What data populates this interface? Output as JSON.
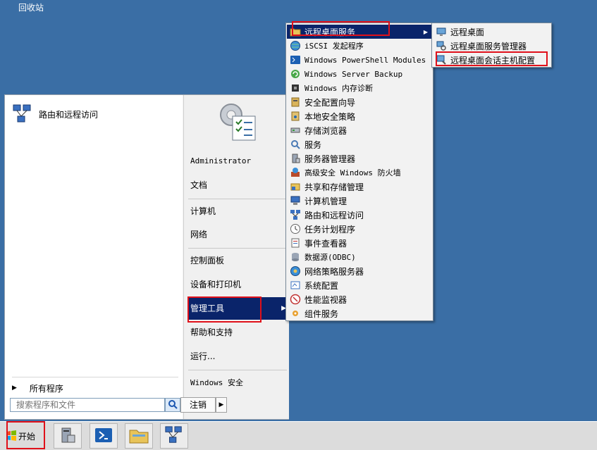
{
  "desktop": {
    "recycle_bin": "回收站"
  },
  "start_menu": {
    "pinned": [
      {
        "label": "路由和远程访问",
        "icon": "network-icon"
      }
    ],
    "all_programs": "所有程序",
    "search_placeholder": "搜索程序和文件",
    "right": {
      "user": "Administrator",
      "items": [
        "文档",
        "计算机",
        "网络",
        "控制面板",
        "设备和打印机",
        "管理工具",
        "帮助和支持",
        "运行..."
      ],
      "security": "Windows 安全",
      "logoff": "注销"
    }
  },
  "admin_tools_menu": {
    "items": [
      {
        "label": "远程桌面服务",
        "icon": "folder-icon"
      },
      {
        "label": "iSCSI 发起程序",
        "icon": "globe-icon"
      },
      {
        "label": "Windows PowerShell Modules",
        "icon": "powershell-icon"
      },
      {
        "label": "Windows Server Backup",
        "icon": "backup-icon"
      },
      {
        "label": "Windows 内存诊断",
        "icon": "chip-icon"
      },
      {
        "label": "安全配置向导",
        "icon": "wizard-icon"
      },
      {
        "label": "本地安全策略",
        "icon": "policy-icon"
      },
      {
        "label": "存储浏览器",
        "icon": "storage-icon"
      },
      {
        "label": "服务",
        "icon": "services-icon"
      },
      {
        "label": "服务器管理器",
        "icon": "server-icon"
      },
      {
        "label": "高级安全 Windows 防火墙",
        "icon": "firewall-icon"
      },
      {
        "label": "共享和存储管理",
        "icon": "share-icon"
      },
      {
        "label": "计算机管理",
        "icon": "computer-icon"
      },
      {
        "label": "路由和远程访问",
        "icon": "network-icon"
      },
      {
        "label": "任务计划程序",
        "icon": "clock-icon"
      },
      {
        "label": "事件查看器",
        "icon": "event-icon"
      },
      {
        "label": "数据源(ODBC)",
        "icon": "database-icon"
      },
      {
        "label": "网络策略服务器",
        "icon": "nps-icon"
      },
      {
        "label": "系统配置",
        "icon": "config-icon"
      },
      {
        "label": "性能监视器",
        "icon": "monitor-icon"
      },
      {
        "label": "组件服务",
        "icon": "gear-icon"
      }
    ]
  },
  "rds_menu": {
    "items": [
      {
        "label": "远程桌面",
        "icon": "remote-desktop-icon"
      },
      {
        "label": "远程桌面服务管理器",
        "icon": "rds-manager-icon"
      },
      {
        "label": "远程桌面会话主机配置",
        "icon": "rdsh-config-icon"
      }
    ]
  },
  "taskbar": {
    "start_label": "开始"
  },
  "colors": {
    "desktop": "#3a6ea5",
    "highlight": "#0a246a",
    "annotation": "#e0101a"
  }
}
